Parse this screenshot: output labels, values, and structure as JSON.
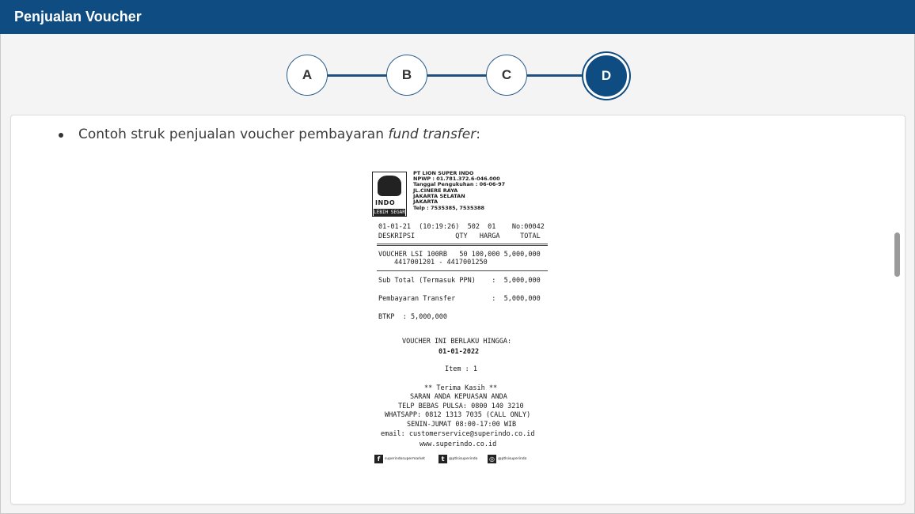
{
  "header": {
    "title": "Penjualan Voucher"
  },
  "stepper": {
    "steps": [
      "A",
      "B",
      "C",
      "D"
    ],
    "active": "D"
  },
  "content": {
    "bullet_prefix": "Contoh struk penjualan voucher pembayaran ",
    "bullet_italic": "fund transfer",
    "bullet_suffix": ":"
  },
  "receipt": {
    "logo_text": "INDO",
    "logo_sub": "LEBIH SEGAR",
    "company_lines": [
      "PT LION SUPER INDO",
      "NPWP : 01.781.372.6-046.000",
      "Tanggal Pengukuhan : 06-06-97",
      "JL.CINERE RAYA",
      "JAKARTA SELATAN",
      "JAKARTA",
      "Telp : 7535385, 7535388"
    ],
    "line_date": "01-01-21  (10:19:26)  502  01    No:00042",
    "line_headers": "DESKRIPSI          QTY   HARGA     TOTAL",
    "item_line": "VOUCHER LSI 100RB   50 100,000 5,000,000",
    "item_serial": "4417001201 - 4417001250",
    "subtotal": "Sub Total (Termasuk PPN)    :  5,000,000",
    "payment": "Pembayaran Transfer         :  5,000,000",
    "btkp": "BTKP  : 5,000,000",
    "valid_until_label": "VOUCHER INI BERLAKU HINGGA:",
    "valid_until_date": "01-01-2022",
    "item_count": "Item : 1",
    "thanks": "** Terima Kasih **",
    "footer_lines": [
      "SARAN ANDA KEPUASAN ANDA",
      "TELP BEBAS PULSA: 0800 140 3210",
      "WHATSAPP: 0812 1313 7035 (CALL ONLY)",
      "SENIN-JUMAT 08:00-17:00 WIB",
      "email: customerservice@superindo.co.id",
      "www.superindo.co.id"
    ],
    "social": [
      "superindosupermarket",
      "@ptlsisuperindo",
      "@ptlsisuperindo"
    ]
  }
}
